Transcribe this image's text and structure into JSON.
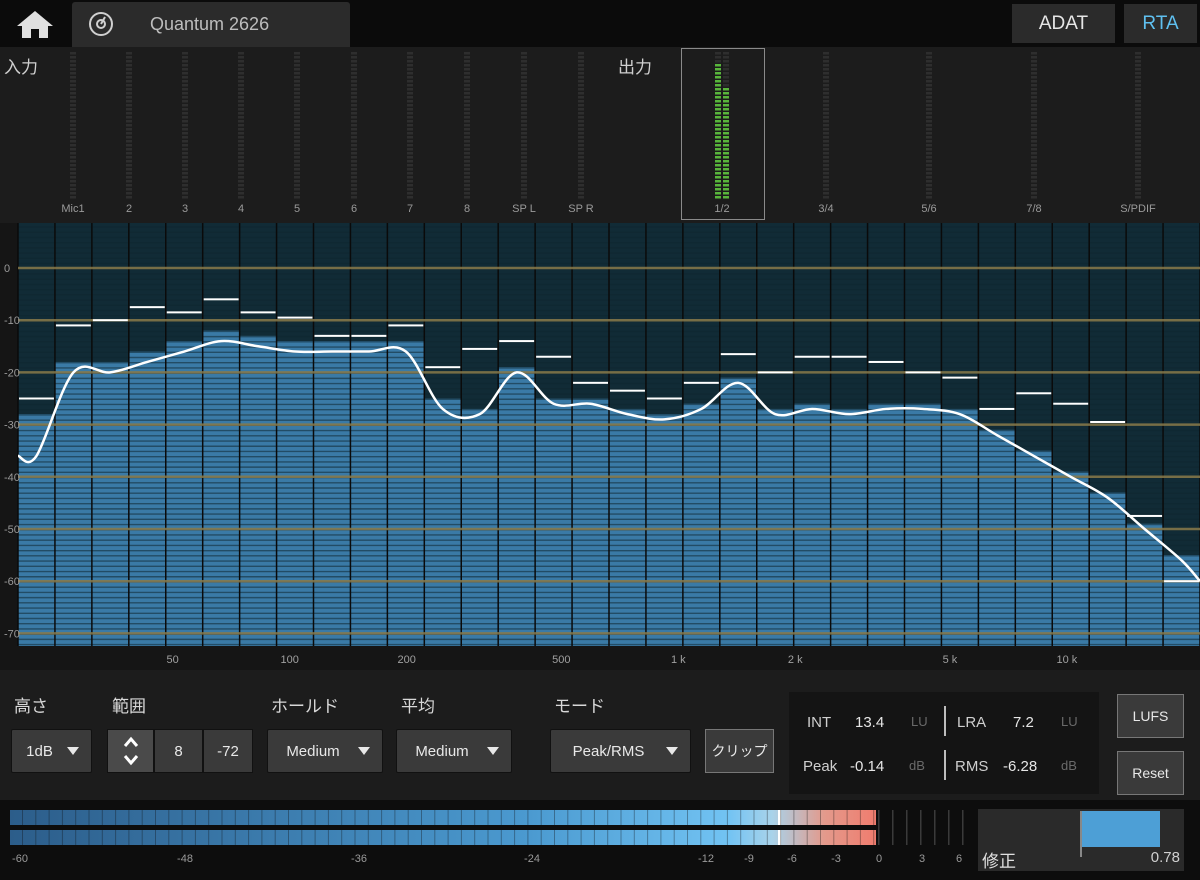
{
  "header": {
    "device_name": "Quantum 2626",
    "tabs": [
      {
        "label": "ADAT"
      },
      {
        "label": "RTA",
        "active": true
      }
    ],
    "accent_color": "#5fc0f0"
  },
  "meters": {
    "input_label": "入力",
    "output_label": "出力",
    "inputs": [
      "Mic1",
      "2",
      "3",
      "4",
      "5",
      "6",
      "7",
      "8",
      "SP L",
      "SP R"
    ],
    "outputs": [
      "1/2",
      "3/4",
      "5/6",
      "7/8",
      "S/PDIF"
    ],
    "selected_output": "1/2",
    "selected_output_levels": [
      0.93,
      0.78
    ]
  },
  "rta": {
    "db_labels": [
      "0",
      "-10",
      "-20",
      "-30",
      "-40",
      "-50",
      "-60",
      "-70"
    ],
    "freq_labels": [
      "50",
      "100",
      "200",
      "500",
      "1 k",
      "2 k",
      "5 k",
      "10 k"
    ],
    "bar_color": "#3a7aa6",
    "curve_color": "#ffffff",
    "band_levels_db": [
      -28,
      -18,
      -18,
      -16,
      -14,
      -12,
      -13,
      -14,
      -14,
      -14,
      -14,
      -25,
      -27,
      -19,
      -25,
      -25,
      -27,
      -28,
      -26,
      -21,
      -27,
      -26,
      -27,
      -26,
      -26,
      -27,
      -31,
      -35,
      -39,
      -43,
      -49,
      -55
    ],
    "peak_hold_db": [
      -25,
      -11,
      -10,
      -7.5,
      -8.5,
      -6,
      -8.5,
      -9.5,
      -13,
      -13,
      -11,
      -19,
      -15.5,
      -14,
      -17,
      -22,
      -23.5,
      -25,
      -22,
      -16.5,
      -20,
      -17,
      -17,
      -18,
      -20,
      -21,
      -27,
      -24,
      -26,
      -29.5,
      -47.5,
      -60
    ]
  },
  "controls": {
    "height_label": "高さ",
    "height_value": "1dB",
    "range_label": "範囲",
    "range_high": "8",
    "range_low": "-72",
    "hold_label": "ホールド",
    "hold_value": "Medium",
    "average_label": "平均",
    "average_value": "Medium",
    "mode_label": "モード",
    "mode_value": "Peak/RMS",
    "clip_label": "クリップ"
  },
  "loudness": {
    "int_label": "INT",
    "int_value": "13.4",
    "int_unit": "LU",
    "lra_label": "LRA",
    "lra_value": "7.2",
    "lra_unit": "LU",
    "peak_label": "Peak",
    "peak_value": "-0.14",
    "peak_unit": "dB",
    "rms_label": "RMS",
    "rms_value": "-6.28",
    "rms_unit": "dB",
    "lufs_button": "LUFS",
    "reset_button": "Reset"
  },
  "bottom_meter": {
    "scale": [
      "-60",
      "-48",
      "-36",
      "-24",
      "-12",
      "-9",
      "-6",
      "-3",
      "0",
      "3",
      "6"
    ]
  },
  "correction": {
    "label": "修正",
    "value": "0.78"
  }
}
